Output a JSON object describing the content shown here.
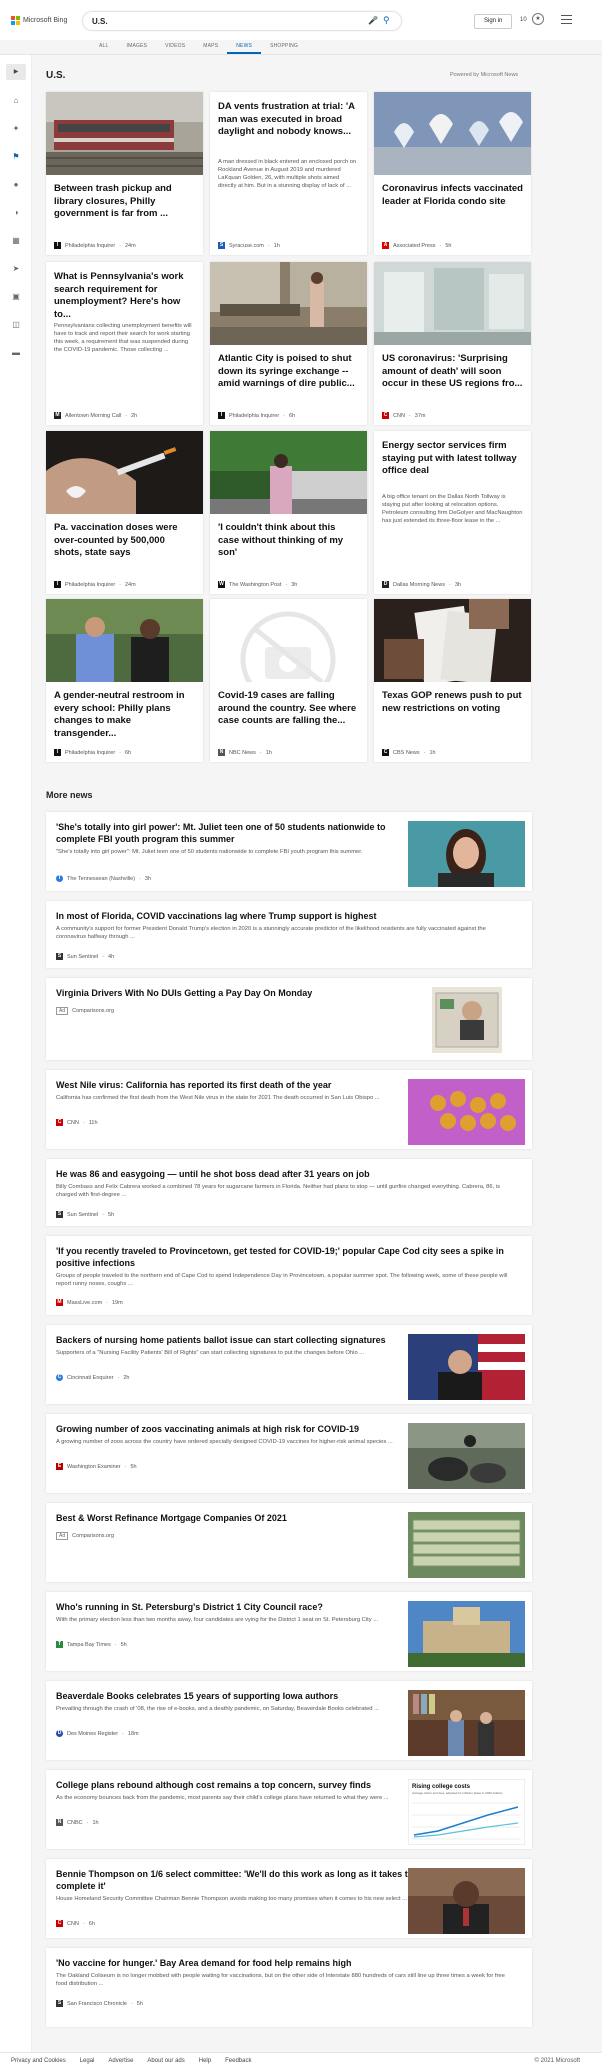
{
  "header": {
    "logo_text": "Microsoft Bing",
    "query": "U.S.",
    "signin": "Sign in",
    "rewards": "10"
  },
  "tabs": [
    "ALL",
    "IMAGES",
    "VIDEOS",
    "MAPS",
    "NEWS",
    "SHOPPING"
  ],
  "active_tab": "NEWS",
  "section_title": "U.S.",
  "powered_by": "Powered by Microsoft News",
  "cards": [
    {
      "title": "Between trash pickup and library closures, Philly government is far from ...",
      "desc": "",
      "source": "Philadelphia Inquirer",
      "time": "24m",
      "icon": "I",
      "icon_color": "#111"
    },
    {
      "title": "DA vents frustration at trial: 'A man was executed in broad daylight and nobody knows...",
      "desc": "A man dressed in black entered an enclosed porch on Rockland Avenue in August 2019 and murdered LaKquan Golden, 26, with multiple shots aimed directly at him. But in a stunning display of lack of ...",
      "source": "Syracuse.com",
      "time": "1h",
      "icon": "S",
      "icon_color": "#1a5fb4"
    },
    {
      "title": "Coronavirus infects vaccinated leader at Florida condo site",
      "desc": "",
      "source": "Associated Press",
      "time": "5h",
      "icon": "AP",
      "icon_color": "#d00"
    },
    {
      "title": "What is Pennsylvania's work search requirement for unemployment? Here's how to...",
      "desc": "Pennsylvanians collecting unemployment benefits will have to track and report their search for work starting this week, a requirement that was suspended during the COVID-19 pandemic. Those collecting ...",
      "source": "Allentown Morning Call",
      "time": "2h",
      "icon": "M",
      "icon_color": "#222"
    },
    {
      "title": "Atlantic City is poised to shut down its syringe exchange -- amid warnings of dire public...",
      "desc": "",
      "source": "Philadelphia Inquirer",
      "time": "6h",
      "icon": "I",
      "icon_color": "#111"
    },
    {
      "title": "US coronavirus: 'Surprising amount of death' will soon occur in these US regions fro...",
      "desc": "",
      "source": "CNN",
      "time": "37m",
      "icon": "C",
      "icon_color": "#cc0000"
    },
    {
      "title": "Pa. vaccination doses were over-counted by 500,000 shots, state says",
      "desc": "",
      "source": "Philadelphia Inquirer",
      "time": "24m",
      "icon": "I",
      "icon_color": "#111"
    },
    {
      "title": "'I couldn't think about this case without thinking of my son'",
      "desc": "",
      "source": "The Washington Post",
      "time": "3h",
      "icon": "W",
      "icon_color": "#111"
    },
    {
      "title": "Energy sector services firm staying put with latest tollway office deal",
      "desc": "A big office tenant on the Dallas North Tollway is staying put after looking at relocation options. Petroleum consulting firm DeGolyer and MacNaughton has just extended its three-floor lease in the ...",
      "source": "Dallas Morning News",
      "time": "3h",
      "icon": "D",
      "icon_color": "#222"
    },
    {
      "title": "A gender-neutral restroom in every school: Philly plans changes to make transgender...",
      "desc": "",
      "source": "Philadelphia Inquirer",
      "time": "6h",
      "icon": "I",
      "icon_color": "#111"
    },
    {
      "title": "Covid-19 cases are falling around the country. See where case counts are falling the...",
      "desc": "",
      "source": "NBC News",
      "time": "1h",
      "icon": "N",
      "icon_color": "#555"
    },
    {
      "title": "Texas GOP renews push to put new restrictions on voting",
      "desc": "",
      "source": "CBS News",
      "time": "1h",
      "icon": "C",
      "icon_color": "#111"
    }
  ],
  "more_news_title": "More news",
  "items": [
    {
      "title": "'She's totally into girl power': Mt. Juliet teen one of 50 students nationwide to complete FBI youth program this summer",
      "desc": "\"She's totally into girl power\": Mt. Juliet teen one of 50 students nationwide to complete FBI youth program this summer.",
      "source": "The Tennessean (Nashville)",
      "time": "3h",
      "icon": "T",
      "icon_color": "#2a7ae2"
    },
    {
      "title": "In most of Florida, COVID vaccinations lag where Trump support is highest",
      "desc": "A community's support for former President Donald Trump's election in 2020 is a stunningly accurate predictor of the likelihood residents are fully vaccinated against the coronavirus halfway through ...",
      "source": "Sun Sentinel",
      "time": "4h",
      "icon": "S",
      "icon_color": "#333"
    },
    {
      "title": "Virginia Drivers With No DUIs Getting a Pay Day On Monday",
      "desc": "",
      "source": "Comparisons.org",
      "time": "",
      "ad": "Ad",
      "icon": "",
      "icon_color": ""
    },
    {
      "title": "West Nile virus: California has reported its first death of the year",
      "desc": "California has confirmed the first death from the West Nile virus in the state for 2021 The death occurred in San Luis Obispo ...",
      "source": "CNN",
      "time": "11h",
      "icon": "C",
      "icon_color": "#cc0000"
    },
    {
      "title": "He was 86 and easygoing — until he shot boss dead after 31 years on job",
      "desc": "Billy Combass and Felix Cabrera worked a combined 78 years for sugarcane farmers in Florida. Neither had plans to stop — until gunfire changed everything. Cabrera, 86, is charged with first-degree ...",
      "source": "Sun Sentinel",
      "time": "5h",
      "icon": "S",
      "icon_color": "#333"
    },
    {
      "title": "'If you recently traveled to Provincetown, get tested for COVID-19;' popular Cape Cod city sees a spike in positive infections",
      "desc": "Groups of people traveled to the northern end of Cape Cod to spend Independence Day in Provincetown, a popular summer spot. The following week, some of these people will report runny noses, coughs ...",
      "source": "MassLive.com",
      "time": "19m",
      "icon": "M",
      "icon_color": "#c00"
    },
    {
      "title": "Backers of nursing home patients ballot issue can start collecting signatures",
      "desc": "Supporters of a \"Nursing Facility Patients' Bill of Rights\" can start collecting signatures to put the changes before Ohio ...",
      "source": "Cincinnati Enquirer",
      "time": "2h",
      "icon": "C",
      "icon_color": "#2a7ae2"
    },
    {
      "title": "Growing number of zoos vaccinating animals at high risk for COVID-19",
      "desc": "A growing number of zoos across the country have ordered specially designed COVID-19 vaccines for higher-risk animal species ...",
      "source": "Washington Examiner",
      "time": "5h",
      "icon": "E",
      "icon_color": "#b00"
    },
    {
      "title": "Best & Worst Refinance Mortgage Companies Of 2021",
      "desc": "",
      "source": "Comparisons.org",
      "time": "",
      "ad": "Ad",
      "icon": "",
      "icon_color": ""
    },
    {
      "title": "Who's running in St. Petersburg's District 1 City Council race?",
      "desc": "With the primary election less than two months away, four candidates are vying for the District 1 seat on St. Petersburg City ...",
      "source": "Tampa Bay Times",
      "time": "5h",
      "icon": "T",
      "icon_color": "#2a8a3e"
    },
    {
      "title": "Beaverdale Books celebrates 15 years of supporting Iowa authors",
      "desc": "Prevailing through the crash of '08, the rise of e-books, and a deathly pandemic, on Saturday, Beaverdale Books celebrated ...",
      "source": "Des Moines Register",
      "time": "18m",
      "icon": "D",
      "icon_color": "#2a4bb0"
    },
    {
      "title": "College plans rebound although cost remains a top concern, survey finds",
      "desc": "As the economy bounces back from the pandemic, most parents say their child's college plans have returned to what they were ...",
      "source": "CNBC",
      "time": "1h",
      "icon": "N",
      "icon_color": "#555"
    },
    {
      "title": "Bennie Thompson on 1/6 select committee: 'We'll do this work as long as it takes to complete it'",
      "desc": "House Homeland Security Committee Chairman Bennie Thompson avoids making too many promises when it comes to his new select ...",
      "source": "CNN",
      "time": "6h",
      "icon": "C",
      "icon_color": "#cc0000"
    },
    {
      "title": "'No vaccine for hunger.' Bay Area demand for food help remains high",
      "desc": "The Oakland Coliseum is no longer mobbed with people waiting for vaccinations, but on the other side of Interstate 880 hundreds of cars still line up three times a week for free food distribution ...",
      "source": "San Francisco Chronicle",
      "time": "5h",
      "icon": "S",
      "icon_color": "#333"
    }
  ],
  "chart_thumb": {
    "title": "Rising college costs",
    "subtitle": "Average tuition and fees, adjusted for inflation (base in 2020 dollars)"
  },
  "footer": {
    "links": [
      "Privacy and Cookies",
      "Legal",
      "Advertise",
      "About our ads",
      "Help",
      "Feedback"
    ],
    "copyright": "© 2021 Microsoft"
  }
}
